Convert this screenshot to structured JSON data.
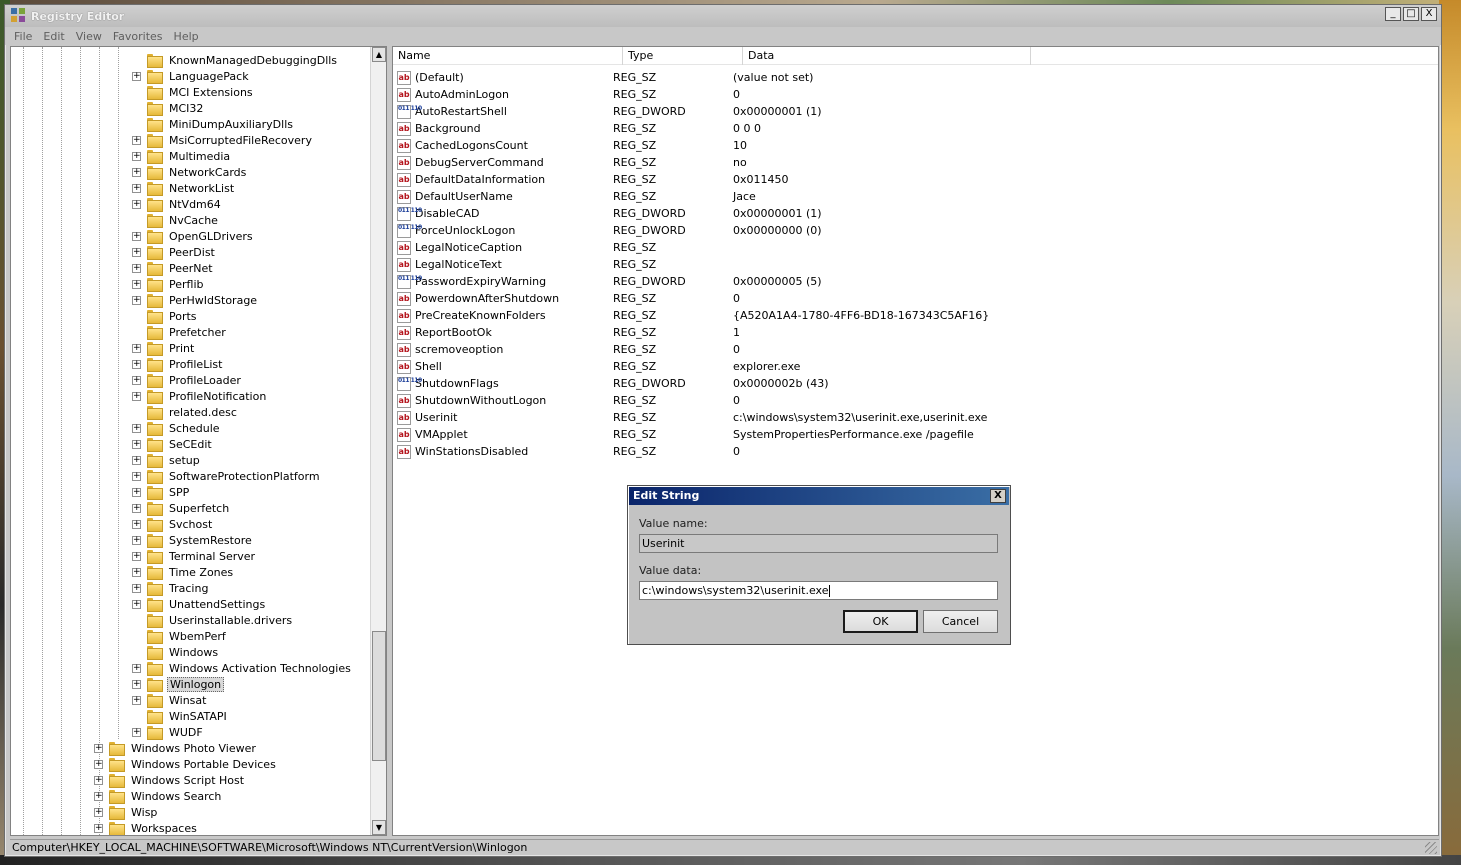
{
  "window": {
    "title": "Registry Editor"
  },
  "title_buttons": {
    "minimize": "_",
    "maximize": "□",
    "close": "X"
  },
  "menu": [
    "File",
    "Edit",
    "View",
    "Favorites",
    "Help"
  ],
  "tree": {
    "items": [
      {
        "label": "KnownManagedDebuggingDlls",
        "expandable": false
      },
      {
        "label": "LanguagePack",
        "expandable": true
      },
      {
        "label": "MCI Extensions",
        "expandable": false
      },
      {
        "label": "MCI32",
        "expandable": false
      },
      {
        "label": "MiniDumpAuxiliaryDlls",
        "expandable": false
      },
      {
        "label": "MsiCorruptedFileRecovery",
        "expandable": true
      },
      {
        "label": "Multimedia",
        "expandable": true
      },
      {
        "label": "NetworkCards",
        "expandable": true
      },
      {
        "label": "NetworkList",
        "expandable": true
      },
      {
        "label": "NtVdm64",
        "expandable": true
      },
      {
        "label": "NvCache",
        "expandable": false
      },
      {
        "label": "OpenGLDrivers",
        "expandable": true
      },
      {
        "label": "PeerDist",
        "expandable": true
      },
      {
        "label": "PeerNet",
        "expandable": true
      },
      {
        "label": "Perflib",
        "expandable": true
      },
      {
        "label": "PerHwIdStorage",
        "expandable": true
      },
      {
        "label": "Ports",
        "expandable": false
      },
      {
        "label": "Prefetcher",
        "expandable": false
      },
      {
        "label": "Print",
        "expandable": true
      },
      {
        "label": "ProfileList",
        "expandable": true
      },
      {
        "label": "ProfileLoader",
        "expandable": true
      },
      {
        "label": "ProfileNotification",
        "expandable": true
      },
      {
        "label": "related.desc",
        "expandable": false
      },
      {
        "label": "Schedule",
        "expandable": true
      },
      {
        "label": "SeCEdit",
        "expandable": true
      },
      {
        "label": "setup",
        "expandable": true
      },
      {
        "label": "SoftwareProtectionPlatform",
        "expandable": true
      },
      {
        "label": "SPP",
        "expandable": true
      },
      {
        "label": "Superfetch",
        "expandable": true
      },
      {
        "label": "Svchost",
        "expandable": true
      },
      {
        "label": "SystemRestore",
        "expandable": true
      },
      {
        "label": "Terminal Server",
        "expandable": true
      },
      {
        "label": "Time Zones",
        "expandable": true
      },
      {
        "label": "Tracing",
        "expandable": true
      },
      {
        "label": "UnattendSettings",
        "expandable": true
      },
      {
        "label": "Userinstallable.drivers",
        "expandable": false
      },
      {
        "label": "WbemPerf",
        "expandable": false
      },
      {
        "label": "Windows",
        "expandable": false
      },
      {
        "label": "Windows Activation Technologies",
        "expandable": true
      },
      {
        "label": "Winlogon",
        "expandable": true,
        "selected": true
      },
      {
        "label": "Winsat",
        "expandable": true
      },
      {
        "label": "WinSATAPI",
        "expandable": false
      },
      {
        "label": "WUDF",
        "expandable": true
      }
    ],
    "parent_items": [
      {
        "label": "Windows Photo Viewer"
      },
      {
        "label": "Windows Portable Devices"
      },
      {
        "label": "Windows Script Host"
      },
      {
        "label": "Windows Search"
      },
      {
        "label": "Wisp"
      },
      {
        "label": "Workspaces"
      }
    ]
  },
  "list": {
    "columns": [
      "Name",
      "Type",
      "Data"
    ],
    "rows": [
      {
        "name": "(Default)",
        "type": "REG_SZ",
        "data": "(value not set)",
        "icon": "string-value-icon"
      },
      {
        "name": "AutoAdminLogon",
        "type": "REG_SZ",
        "data": "0",
        "icon": "string-value-icon"
      },
      {
        "name": "AutoRestartShell",
        "type": "REG_DWORD",
        "data": "0x00000001 (1)",
        "icon": "dword-value-icon"
      },
      {
        "name": "Background",
        "type": "REG_SZ",
        "data": "0 0 0",
        "icon": "string-value-icon"
      },
      {
        "name": "CachedLogonsCount",
        "type": "REG_SZ",
        "data": "10",
        "icon": "string-value-icon"
      },
      {
        "name": "DebugServerCommand",
        "type": "REG_SZ",
        "data": "no",
        "icon": "string-value-icon"
      },
      {
        "name": "DefaultDataInformation",
        "type": "REG_SZ",
        "data": "0x011450",
        "icon": "string-value-icon"
      },
      {
        "name": "DefaultUserName",
        "type": "REG_SZ",
        "data": "Jace",
        "icon": "string-value-icon"
      },
      {
        "name": "DisableCAD",
        "type": "REG_DWORD",
        "data": "0x00000001 (1)",
        "icon": "dword-value-icon"
      },
      {
        "name": "ForceUnlockLogon",
        "type": "REG_DWORD",
        "data": "0x00000000 (0)",
        "icon": "dword-value-icon"
      },
      {
        "name": "LegalNoticeCaption",
        "type": "REG_SZ",
        "data": "",
        "icon": "string-value-icon"
      },
      {
        "name": "LegalNoticeText",
        "type": "REG_SZ",
        "data": "",
        "icon": "string-value-icon"
      },
      {
        "name": "PasswordExpiryWarning",
        "type": "REG_DWORD",
        "data": "0x00000005 (5)",
        "icon": "dword-value-icon"
      },
      {
        "name": "PowerdownAfterShutdown",
        "type": "REG_SZ",
        "data": "0",
        "icon": "string-value-icon"
      },
      {
        "name": "PreCreateKnownFolders",
        "type": "REG_SZ",
        "data": "{A520A1A4-1780-4FF6-BD18-167343C5AF16}",
        "icon": "string-value-icon"
      },
      {
        "name": "ReportBootOk",
        "type": "REG_SZ",
        "data": "1",
        "icon": "string-value-icon"
      },
      {
        "name": "scremoveoption",
        "type": "REG_SZ",
        "data": "0",
        "icon": "string-value-icon"
      },
      {
        "name": "Shell",
        "type": "REG_SZ",
        "data": "explorer.exe",
        "icon": "string-value-icon"
      },
      {
        "name": "ShutdownFlags",
        "type": "REG_DWORD",
        "data": "0x0000002b (43)",
        "icon": "dword-value-icon"
      },
      {
        "name": "ShutdownWithoutLogon",
        "type": "REG_SZ",
        "data": "0",
        "icon": "string-value-icon"
      },
      {
        "name": "Userinit",
        "type": "REG_SZ",
        "data": "c:\\windows\\system32\\userinit.exe,userinit.exe",
        "icon": "string-value-icon"
      },
      {
        "name": "VMApplet",
        "type": "REG_SZ",
        "data": "SystemPropertiesPerformance.exe /pagefile",
        "icon": "string-value-icon"
      },
      {
        "name": "WinStationsDisabled",
        "type": "REG_SZ",
        "data": "0",
        "icon": "string-value-icon"
      }
    ]
  },
  "status": {
    "path": "Computer\\HKEY_LOCAL_MACHINE\\SOFTWARE\\Microsoft\\Windows NT\\CurrentVersion\\Winlogon"
  },
  "dialog": {
    "title": "Edit String",
    "close": "X",
    "value_name_label": "Value name:",
    "value_name": "Userinit",
    "value_data_label": "Value data:",
    "value_data": "c:\\windows\\system32\\userinit.exe",
    "ok": "OK",
    "cancel": "Cancel"
  },
  "colors": {
    "dialog_title_start": "#0a246a",
    "dialog_title_end": "#3a6ea5",
    "string_icon": "#b4141c",
    "dword_icon": "#1d3f9a"
  }
}
